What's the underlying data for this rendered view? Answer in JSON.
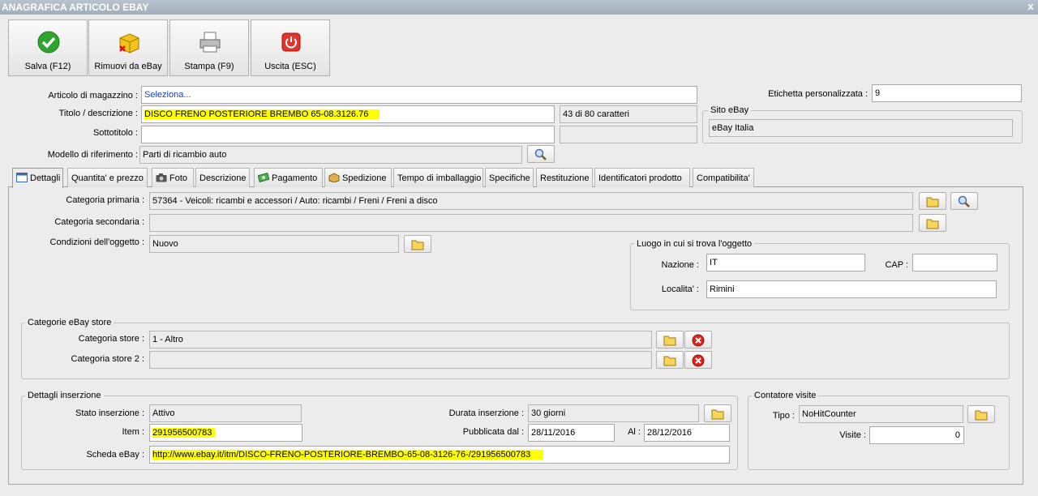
{
  "window": {
    "title": "ANAGRAFICA ARTICOLO EBAY",
    "close": "x"
  },
  "toolbar": {
    "save": "Salva (F12)",
    "remove": "Rimuovi da eBay",
    "print": "Stampa (F9)",
    "exit": "Uscita (ESC)"
  },
  "header": {
    "article_label": "Articolo di magazzino :",
    "article_value": "Seleziona...",
    "title_label": "Titolo / descrizione :",
    "title_value": "DISCO FRENO POSTERIORE BREMBO 65-08.3126.76",
    "char_count": "43 di 80 caratteri",
    "subtitle_label": "Sottotitolo :",
    "subtitle_value": "",
    "subtitle_count": "",
    "model_label": "Modello di riferimento :",
    "model_value": "Parti di ricambio auto",
    "custom_label_label": "Etichetta personalizzata :",
    "custom_label_value": "9",
    "site_group": "Sito eBay",
    "site_value": "eBay Italia"
  },
  "tabs": [
    {
      "label": "Dettagli",
      "icon": "calendar-icon"
    },
    {
      "label": "Quantita' e prezzo",
      "icon": ""
    },
    {
      "label": "Foto",
      "icon": "camera-icon"
    },
    {
      "label": "Descrizione",
      "icon": ""
    },
    {
      "label": "Pagamento",
      "icon": "money-icon"
    },
    {
      "label": "Spedizione",
      "icon": "box-icon"
    },
    {
      "label": "Tempo di imballaggio",
      "icon": ""
    },
    {
      "label": "Specifiche",
      "icon": ""
    },
    {
      "label": "Restituzione",
      "icon": ""
    },
    {
      "label": "Identificatori prodotto",
      "icon": ""
    },
    {
      "label": "Compatibilita'",
      "icon": ""
    }
  ],
  "details": {
    "primary_cat_label": "Categoria primaria :",
    "primary_cat_value": "57364 - Veicoli: ricambi e accessori / Auto: ricambi / Freni / Freni a disco",
    "secondary_cat_label": "Categoria secondaria :",
    "secondary_cat_value": "",
    "condition_label": "Condizioni dell'oggetto :",
    "condition_value": "Nuovo",
    "location_group": "Luogo in cui si trova l'oggetto",
    "nation_label": "Nazione :",
    "nation_value": "IT",
    "cap_label": "CAP :",
    "cap_value": "",
    "city_label": "Localita' :",
    "city_value": "Rimini",
    "store_group": "Categorie eBay store",
    "store_cat_label": "Categoria store :",
    "store_cat_value": "1 - Altro",
    "store_cat2_label": "Categoria store 2 :",
    "store_cat2_value": "",
    "listing_group": "Dettagli inserzione",
    "status_label": "Stato inserzione :",
    "status_value": "Attivo",
    "duration_label": "Durata inserzione :",
    "duration_value": "30 giorni",
    "item_label": "Item :",
    "item_value": "291956500783",
    "published_label": "Pubblicata dal :",
    "published_value": "28/11/2016",
    "to_label": "Al :",
    "to_value": "28/12/2016",
    "sheet_label": "Scheda eBay :",
    "sheet_value": "http://www.ebay.it/itm/DISCO-FRENO-POSTERIORE-BREMBO-65-08-3126-76-/291956500783",
    "counter_group": "Contatore visite",
    "type_label": "Tipo :",
    "type_value": "NoHitCounter",
    "visits_label": "Visite :",
    "visits_value": "0"
  }
}
